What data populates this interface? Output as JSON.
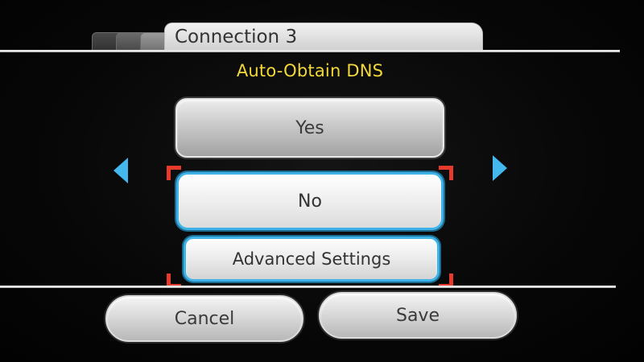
{
  "header": {
    "tab_title": "Connection 3"
  },
  "setting": {
    "title": "Auto-Obtain DNS"
  },
  "options": {
    "yes_label": "Yes",
    "no_label": "No",
    "advanced_label": "Advanced Settings"
  },
  "footer": {
    "cancel_label": "Cancel",
    "save_label": "Save"
  },
  "icons": {
    "left": "arrow-left-icon",
    "right": "arrow-right-icon"
  },
  "colors": {
    "title_yellow": "#f3d83a",
    "selection_blue": "#3fb3e8",
    "cursor_red": "#e53a2c"
  }
}
